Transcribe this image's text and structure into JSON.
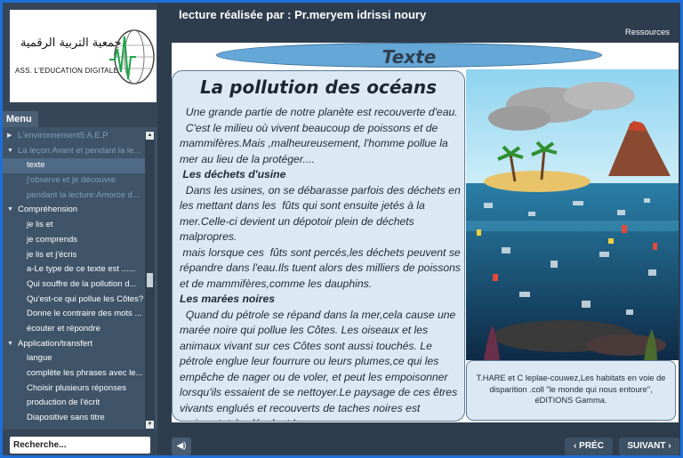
{
  "header": {
    "title": "lecture réalisée par : Pr.meryem idrissi noury",
    "resources_label": "Ressources"
  },
  "logo": {
    "arabic_name": "جمعية التربية الرقمية",
    "latin_name": "ASS. L'EDUCATION DIGITALE"
  },
  "sidebar": {
    "menu_tab_label": "Menu",
    "items": [
      {
        "label": "L'environnement5  A.E.P",
        "level": 0,
        "dim": true,
        "arrow": "▶"
      },
      {
        "label": "La leçon:Avant et pendant la le...",
        "level": 0,
        "dim": true,
        "arrow": "▼"
      },
      {
        "label": "texte",
        "level": 1,
        "selected": true
      },
      {
        "label": "j'observe et je découvre",
        "level": 1,
        "dim": true
      },
      {
        "label": "pendant la lecture:Amorce d...",
        "level": 1,
        "dim": true
      },
      {
        "label": "Compréhension",
        "level": 0,
        "arrow": "▼"
      },
      {
        "label": "je lis et",
        "level": 1
      },
      {
        "label": "je comprends",
        "level": 1
      },
      {
        "label": "je lis et j'écris",
        "level": 1
      },
      {
        "label": "a-Le type de ce texte est ......",
        "level": 1
      },
      {
        "label": "Qui souffre de la pollution d...",
        "level": 1
      },
      {
        "label": "Qu'est-ce qui pollue les Côtes?",
        "level": 1
      },
      {
        "label": "Donne le contraire des mots ...",
        "level": 1
      },
      {
        "label": "écouter et répondre",
        "level": 1
      },
      {
        "label": "Application/transfert",
        "level": 0,
        "arrow": "▼"
      },
      {
        "label": "langue",
        "level": 1
      },
      {
        "label": "complète les phrases avec le...",
        "level": 1
      },
      {
        "label": "Choisir plusieurs réponses",
        "level": 1
      },
      {
        "label": "production de l'écrit",
        "level": 1
      },
      {
        "label": "Diapositive sans titre",
        "level": 1
      }
    ],
    "search_placeholder": "Recherche..."
  },
  "slide": {
    "banner": "Texte",
    "text_title": "La pollution des océans",
    "paragraphs": [
      {
        "text": "  Une grande partie de notre planète est recouverte d'eau.",
        "sub": false
      },
      {
        "text": "  C'est le milieu où vivent beaucoup de poissons et de mammifères.Mais ,malheureusement, l'homme pollue la mer au lieu de la protéger....",
        "sub": false
      },
      {
        "text": " Les déchets d'usine",
        "sub": true
      },
      {
        "text": "  Dans les usines, on se débarasse parfois des déchets en les mettant dans les  fûts qui sont ensuite jetés à la mer.Celle-ci devient un dépotoir plein de déchets malpropres.",
        "sub": false
      },
      {
        "text": " mais lorsque ces  fûts sont percés,les déchets peuvent se répandre dans l'eau.Ils tuent alors des milliers de poissons et de mammifères,comme les dauphins.",
        "sub": false
      },
      {
        "text": "Les marées noires",
        "sub": true
      },
      {
        "text": "  Quand du pétrole se répand dans la mer,cela cause une marée noire qui pollue les Côtes. Les oiseaux et les animaux vivant sur ces Côtes sont aussi touchés. Le pétrole englue leur fourrure ou leurs plumes,ce qui les empêche de nager ou de voler, et peut les empoisonner lorsqu'ils essaient de se nettoyer.Le paysage de ces êtres vivants englués et recouverts de taches noires est vraiment  très désolant !",
        "sub": false
      }
    ],
    "caption": "T.HARE et C leplae-couwez,Les habitats en voie de disparition .coll \"le monde qui nous entoure\", éDITIONS Gamma."
  },
  "controls": {
    "prev_label": "‹ PRÉC",
    "next_label": "SUIVANT ›",
    "sound_icon": "◀)"
  },
  "colors": {
    "frame_border": "#1f6fd8",
    "banner": "#65a7d6",
    "text_panel": "#dde9f2"
  }
}
